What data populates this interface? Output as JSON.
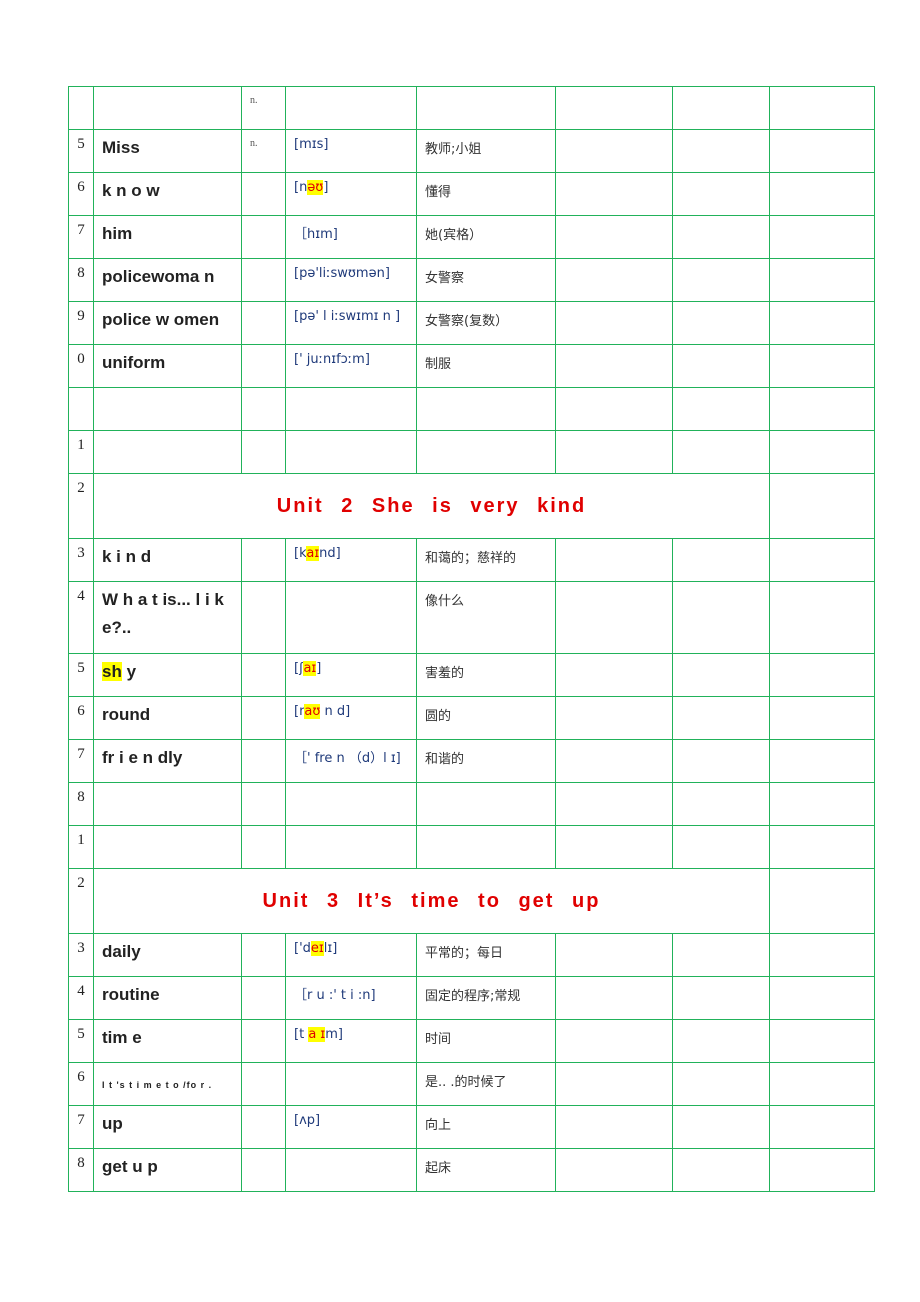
{
  "rows": [
    {
      "num": "",
      "word": "",
      "pos": "n.",
      "ipa": "",
      "cn": ""
    },
    {
      "num": "5",
      "word": "Miss",
      "pos": "n.",
      "ipa": "[mɪs]",
      "cn": "教师;小姐"
    },
    {
      "num": "6",
      "word": "k n o w",
      "pos": "",
      "ipa_pre": "[n",
      "ipa_hl": "əʊ",
      "ipa_post": "]",
      "cn": "懂得"
    },
    {
      "num": "7",
      "word": "him",
      "pos": "",
      "ipa": "［hɪm]",
      "cn": "她(宾格）"
    },
    {
      "num": "8",
      "word": "policewoma n",
      "pos": "",
      "ipa": "[pə'liːswʊmən]",
      "cn": "女警察"
    },
    {
      "num": "9",
      "word": "police w omen",
      "pos": "",
      "ipa": "[pə' l iːswɪmɪ n ]",
      "cn": "女警察(复数）"
    },
    {
      "num": "0",
      "word": "uniform",
      "pos": "",
      "ipa": "['  juːnɪfɔːm]",
      "cn": "制服"
    },
    {
      "num": "",
      "word": "",
      "pos": "",
      "ipa": "",
      "cn": ""
    },
    {
      "num": "1",
      "word": "",
      "pos": "",
      "ipa": "",
      "cn": ""
    }
  ],
  "unit2": {
    "num": "2",
    "title": "Unit 2 She is very kind"
  },
  "unit2_rows": [
    {
      "num": "3",
      "word": "k i n d",
      "ipa_pre": "[k",
      "ipa_hl": "aɪ",
      "ipa_post": "nd]",
      "cn": "和蔼的；慈祥的"
    },
    {
      "num": "4",
      "word": "W h a t   is... l i k e?..",
      "ipa": "",
      "cn": "像什么"
    },
    {
      "num": "5",
      "word_hl": "sh",
      "word_post": " y",
      "ipa_pre": "[ʃ",
      "ipa_hl": "aɪ",
      "ipa_post": "]",
      "cn": "害羞的"
    },
    {
      "num": "6",
      "word": "round",
      "ipa_pre": "[r",
      "ipa_hl": "aʊ",
      "ipa_post": " n d]",
      "cn": "圆的"
    },
    {
      "num": "7",
      "word": "fr i e n dly",
      "ipa": "［' fre n （d）l ɪ]",
      "cn": "和谐的"
    },
    {
      "num": "8",
      "word": "",
      "ipa": "",
      "cn": ""
    },
    {
      "num": "1",
      "word": "",
      "ipa": "",
      "cn": ""
    }
  ],
  "unit3": {
    "num": "2",
    "title": "Unit 3 It’s  time to  get up"
  },
  "unit3_rows": [
    {
      "num": "3",
      "word": "daily",
      "ipa_pre": "['d",
      "ipa_hl": "eɪ",
      "ipa_post": "lɪ]",
      "cn": "平常的；每日"
    },
    {
      "num": "4",
      "word": "routine",
      "ipa": "［r u :' t i :n]",
      "cn": "固定的程序;常规"
    },
    {
      "num": "5",
      "word": "tim e",
      "ipa_pre": "[t ",
      "ipa_hl": "a ɪ",
      "ipa_post": "m]",
      "cn": "时间"
    },
    {
      "num": "6",
      "word": "I t 's t i m e t o /fo r .",
      "ipa": "",
      "cn": "是.. .的时候了"
    },
    {
      "num": "7",
      "word": "up",
      "ipa": "[ʌp]",
      "cn": "向上"
    },
    {
      "num": "8",
      "word": "get   u p",
      "ipa": "",
      "cn": "起床"
    }
  ]
}
